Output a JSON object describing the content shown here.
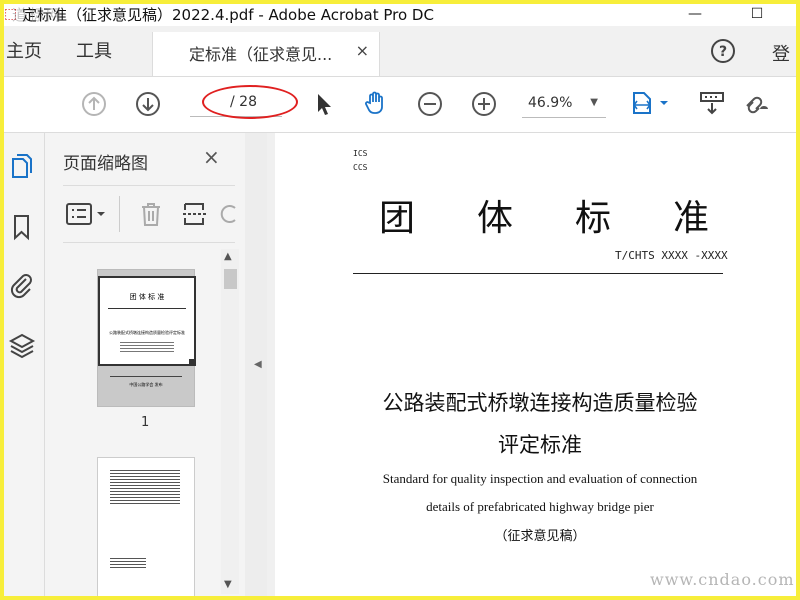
{
  "window": {
    "title": "定标准（征求意见稿）2022.4.pdf - Adobe Acrobat Pro DC",
    "watermark_left": "道标网",
    "minimize": "—",
    "maximize": "☐"
  },
  "menu": {
    "home": "主页",
    "tools": "工具",
    "tab_label": "定标准（征求意见...",
    "tab_close": "×",
    "login": "登"
  },
  "toolbar": {
    "page_current": "",
    "page_total": "/ 28",
    "zoom": "46.9%",
    "annotation_color": "#e02020",
    "accent_color": "#1a73c8"
  },
  "thumb_panel": {
    "title": "页面缩略图",
    "close": "×",
    "page1_label": "1",
    "thumb1_heading": "团 体 标 准",
    "thumb1_title": "公路装配式桥墩连接构造质量检验评定标准",
    "thumb1_footer": "中国公路学会 发布"
  },
  "document": {
    "ics": "ICS",
    "ccs": "CCS",
    "heading_chars": [
      "团",
      "体",
      "标",
      "准"
    ],
    "code": "T/CHTS XXXX -XXXX",
    "title_cn_line1": "公路装配式桥墩连接构造质量检验",
    "title_cn_line2": "评定标准",
    "title_en_line1": "Standard for quality inspection and evaluation of connection",
    "title_en_line2": "details of prefabricated highway bridge pier",
    "note": "（征求意见稿）"
  },
  "watermark_right": "www.cndao.com"
}
